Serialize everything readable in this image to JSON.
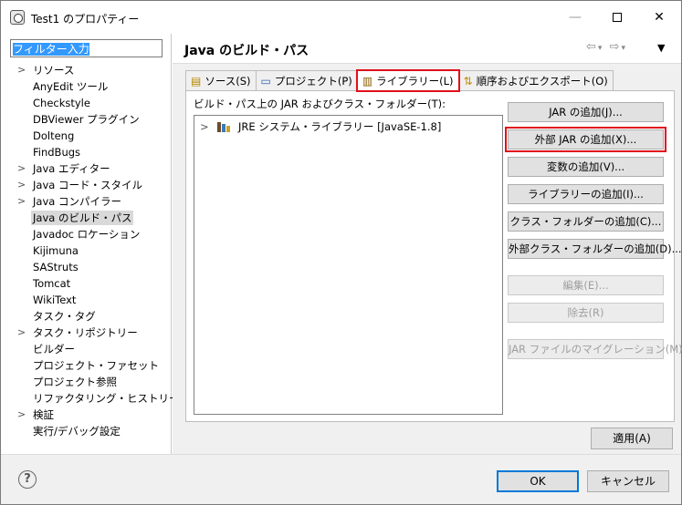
{
  "window": {
    "title": "Test1 のプロパティー",
    "minimize_glyph": "—",
    "close_glyph": "✕"
  },
  "filter": {
    "value": "フィルター入力"
  },
  "tree": {
    "items": [
      {
        "label": "リソース",
        "expandable": true
      },
      {
        "label": "AnyEdit ツール",
        "expandable": false
      },
      {
        "label": "Checkstyle",
        "expandable": false
      },
      {
        "label": "DBViewer プラグイン",
        "expandable": false
      },
      {
        "label": "Dolteng",
        "expandable": false
      },
      {
        "label": "FindBugs",
        "expandable": false
      },
      {
        "label": "Java エディター",
        "expandable": true
      },
      {
        "label": "Java コード・スタイル",
        "expandable": true
      },
      {
        "label": "Java コンパイラー",
        "expandable": true
      },
      {
        "label": "Java のビルド・パス",
        "expandable": false,
        "selected": true
      },
      {
        "label": "Javadoc ロケーション",
        "expandable": false
      },
      {
        "label": "Kijimuna",
        "expandable": false
      },
      {
        "label": "SAStruts",
        "expandable": false
      },
      {
        "label": "Tomcat",
        "expandable": false
      },
      {
        "label": "WikiText",
        "expandable": false
      },
      {
        "label": "タスク・タグ",
        "expandable": false
      },
      {
        "label": "タスク・リポジトリー",
        "expandable": true
      },
      {
        "label": "ビルダー",
        "expandable": false
      },
      {
        "label": "プロジェクト・ファセット",
        "expandable": false
      },
      {
        "label": "プロジェクト参照",
        "expandable": false
      },
      {
        "label": "リファクタリング・ヒストリー",
        "expandable": false
      },
      {
        "label": "検証",
        "expandable": true
      },
      {
        "label": "実行/デバッグ設定",
        "expandable": false
      }
    ]
  },
  "page": {
    "title": "Java のビルド・パス",
    "nav": {
      "back": "⇦",
      "forward": "⇨",
      "dropdown": "▾",
      "menu": "▼"
    }
  },
  "tabs": [
    {
      "label": "ソース(S)",
      "icon": "source-folder-icon"
    },
    {
      "label": "プロジェクト(P)",
      "icon": "project-folder-icon"
    },
    {
      "label": "ライブラリー(L)",
      "icon": "library-icon",
      "active": true,
      "highlighted": true
    },
    {
      "label": "順序およびエクスポート(O)",
      "icon": "order-export-icon"
    }
  ],
  "libraries": {
    "label": "ビルド・パス上の JAR およびクラス・フォルダー(T):",
    "entries": [
      {
        "label": "JRE システム・ライブラリー [JavaSE-1.8]"
      }
    ]
  },
  "buttons": {
    "add_jar": "JAR の追加(J)...",
    "add_external_jar": "外部 JAR の追加(X)...",
    "add_variable": "変数の追加(V)...",
    "add_library": "ライブラリーの追加(I)...",
    "add_class_folder": "クラス・フォルダーの追加(C)...",
    "add_external_class_folder": "外部クラス・フォルダーの追加(D)...",
    "edit": "編集(E)...",
    "remove": "除去(R)",
    "migrate_jar": "JAR ファイルのマイグレーション(M)...",
    "apply": "適用(A)",
    "ok": "OK",
    "cancel": "キャンセル"
  },
  "colors": {
    "highlight": "#e0101a",
    "selection": "#3399ff",
    "ok_border": "#0078d7"
  }
}
